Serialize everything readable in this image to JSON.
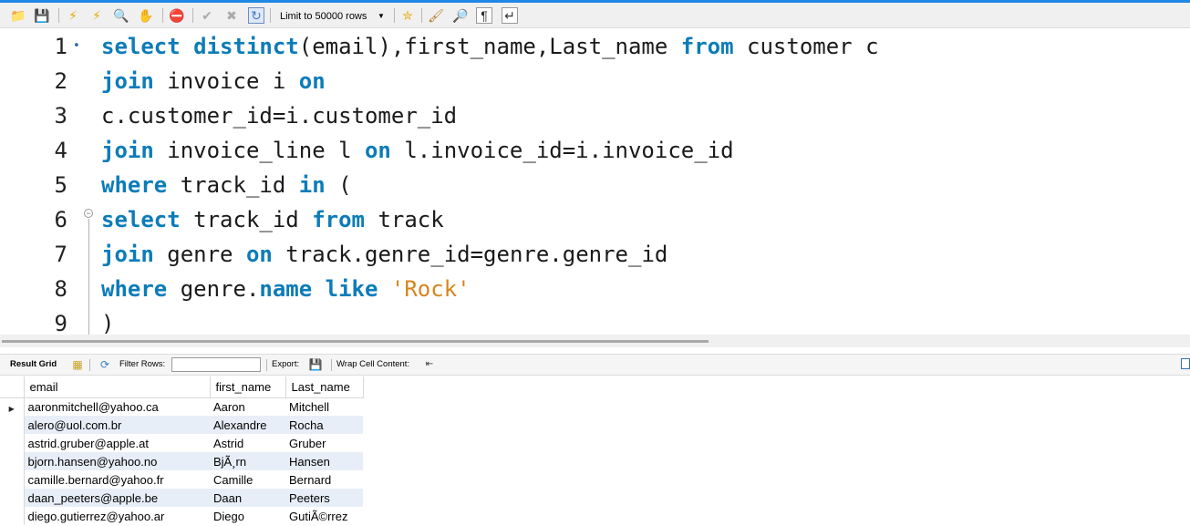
{
  "toolbar": {
    "limit_label": "Limit to 50000 rows",
    "icons": [
      "open-folder-icon",
      "save-icon",
      "execute-icon",
      "execute-current-icon",
      "explain-icon",
      "stop-icon",
      "toggle-error-icon",
      "commit-icon",
      "rollback-icon",
      "autocommit-icon",
      "beautify-icon",
      "find-icon",
      "invisible-chars-icon",
      "wrap-icon"
    ]
  },
  "editor": {
    "lines": [
      {
        "num": "1",
        "tokens": [
          {
            "t": "select",
            "c": "kw"
          },
          {
            "t": " "
          },
          {
            "t": "distinct",
            "c": "kw"
          },
          {
            "t": "(email),first_name,Last_name "
          },
          {
            "t": "from",
            "c": "kw"
          },
          {
            "t": " customer c"
          }
        ]
      },
      {
        "num": "2",
        "tokens": [
          {
            "t": "join",
            "c": "kw"
          },
          {
            "t": " invoice i "
          },
          {
            "t": "on",
            "c": "kw"
          }
        ]
      },
      {
        "num": "3",
        "tokens": [
          {
            "t": "c.customer_id=i.customer_id"
          }
        ]
      },
      {
        "num": "4",
        "tokens": [
          {
            "t": "join",
            "c": "kw"
          },
          {
            "t": " invoice_line l "
          },
          {
            "t": "on",
            "c": "kw"
          },
          {
            "t": " l.invoice_id=i.invoice_id"
          }
        ]
      },
      {
        "num": "5",
        "tokens": [
          {
            "t": "where",
            "c": "kw"
          },
          {
            "t": " track_id "
          },
          {
            "t": "in",
            "c": "kw"
          },
          {
            "t": " ("
          }
        ]
      },
      {
        "num": "6",
        "tokens": [
          {
            "t": "select",
            "c": "kw"
          },
          {
            "t": " track_id "
          },
          {
            "t": "from",
            "c": "kw"
          },
          {
            "t": " track"
          }
        ]
      },
      {
        "num": "7",
        "tokens": [
          {
            "t": "join",
            "c": "kw"
          },
          {
            "t": " genre "
          },
          {
            "t": "on",
            "c": "kw"
          },
          {
            "t": " track.genre_id=genre.genre_id"
          }
        ]
      },
      {
        "num": "8",
        "tokens": [
          {
            "t": "where",
            "c": "kw"
          },
          {
            "t": " genre."
          },
          {
            "t": "name",
            "c": "kw"
          },
          {
            "t": " "
          },
          {
            "t": "like",
            "c": "kw"
          },
          {
            "t": " "
          },
          {
            "t": "'Rock'",
            "c": "str"
          }
        ]
      },
      {
        "num": "9",
        "tokens": [
          {
            "t": ")"
          }
        ]
      }
    ]
  },
  "result_bar": {
    "result_grid_label": "Result Grid",
    "filter_rows_label": "Filter Rows:",
    "filter_value": "",
    "export_label": "Export:",
    "wrap_label": "Wrap Cell Content:"
  },
  "grid": {
    "columns": [
      "email",
      "first_name",
      "Last_name"
    ],
    "rows": [
      [
        "aaronmitchell@yahoo.ca",
        "Aaron",
        "Mitchell"
      ],
      [
        "alero@uol.com.br",
        "Alexandre",
        "Rocha"
      ],
      [
        "astrid.gruber@apple.at",
        "Astrid",
        "Gruber"
      ],
      [
        "bjorn.hansen@yahoo.no",
        "BjÃ¸rn",
        "Hansen"
      ],
      [
        "camille.bernard@yahoo.fr",
        "Camille",
        "Bernard"
      ],
      [
        "daan_peeters@apple.be",
        "Daan",
        "Peeters"
      ],
      [
        "diego.gutierrez@yahoo.ar",
        "Diego",
        "GutiÃ©rrez"
      ]
    ]
  }
}
